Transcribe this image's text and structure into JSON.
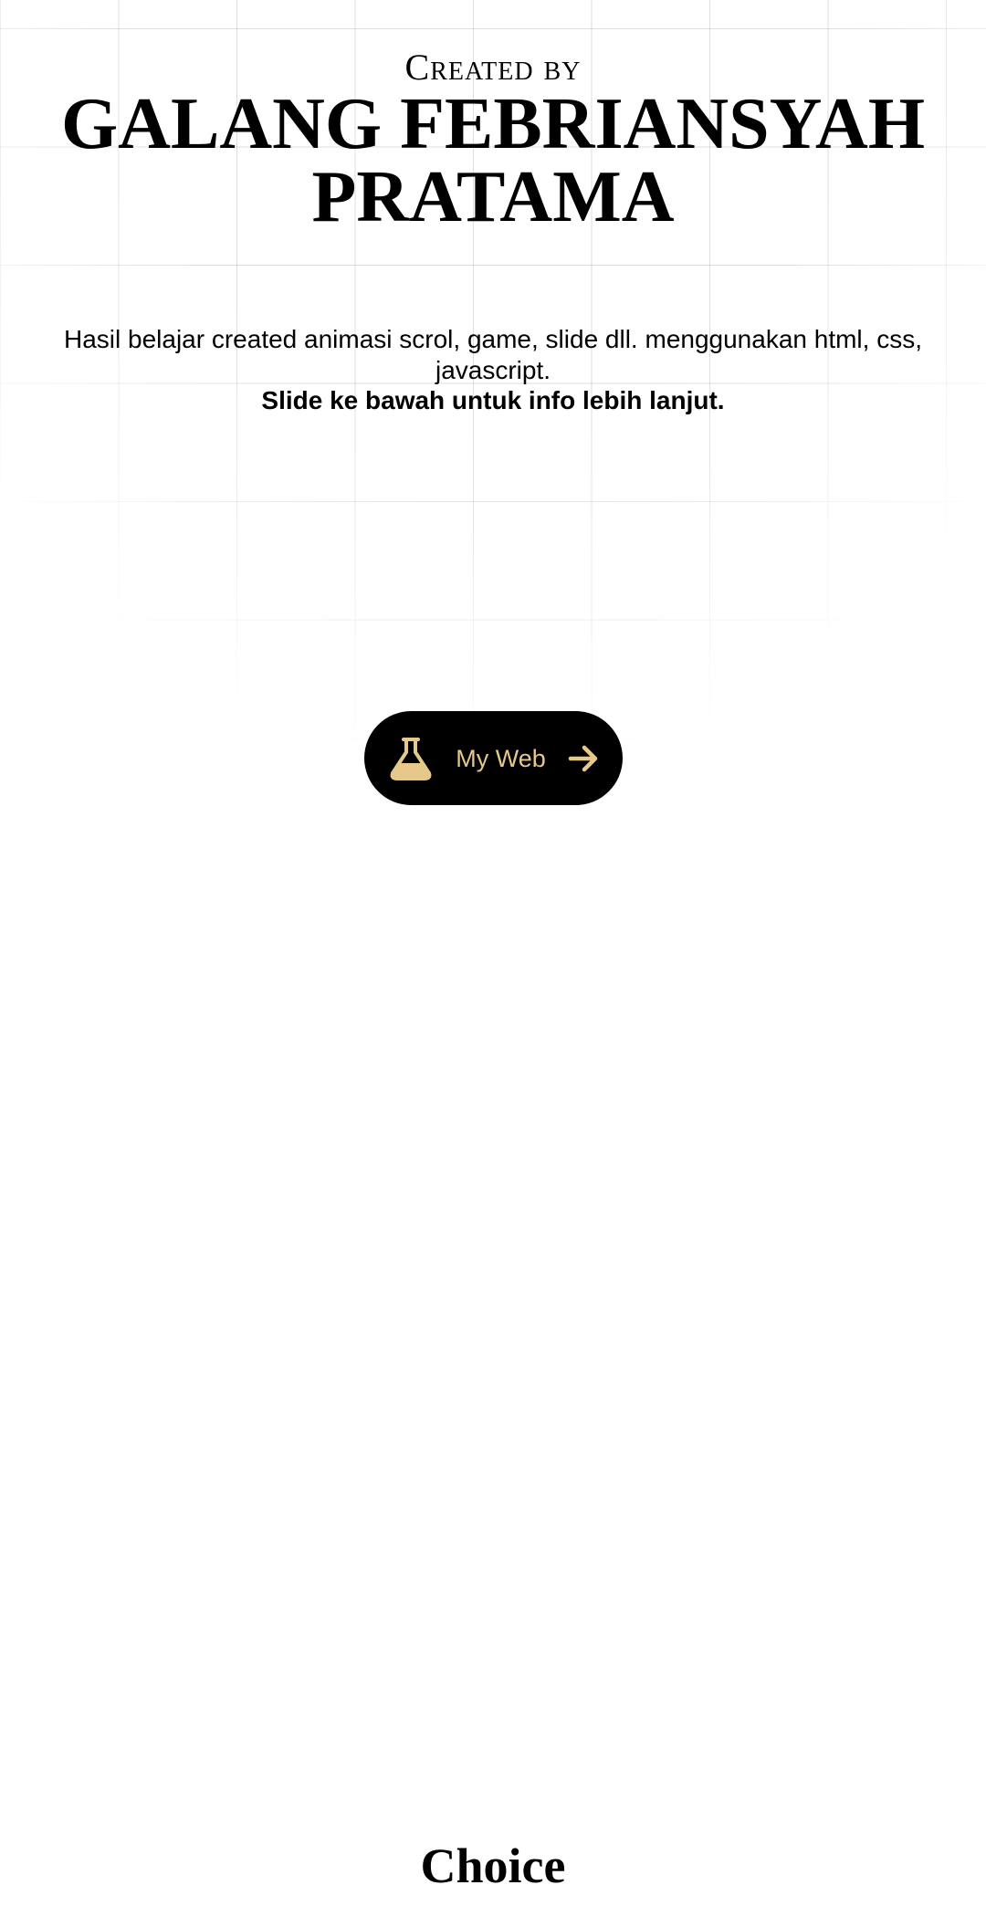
{
  "hero": {
    "created_by": "Created by",
    "author_name": "GALANG FEBRIANSYAH PRATAMA",
    "description": "Hasil belajar created animasi scrol, game, slide dll. menggunakan html, css, javascript.",
    "description_bold": "Slide ke bawah untuk info lebih lanjut."
  },
  "button": {
    "label": "My Web",
    "icon": "flask-icon",
    "trailing_icon": "arrow-right-icon",
    "background": "#000000",
    "text_color": "#e6c88a"
  },
  "next_section": {
    "title": "Choice"
  }
}
